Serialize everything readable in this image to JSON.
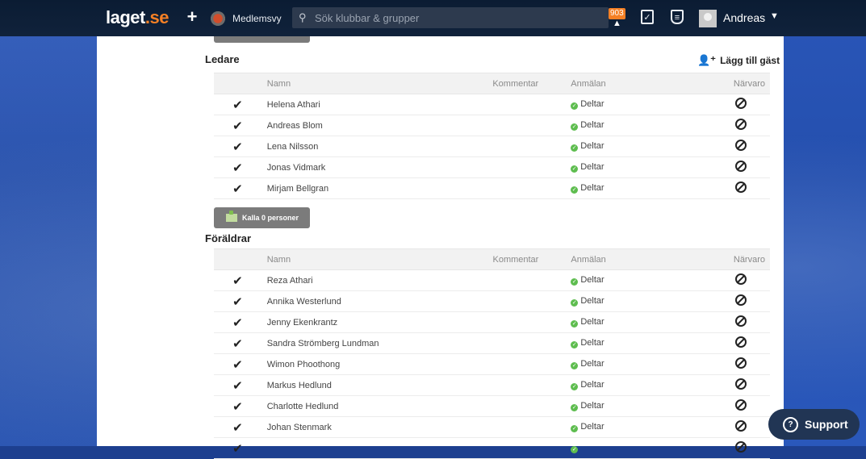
{
  "nav": {
    "logo_main": "laget",
    "logo_suffix": ".se",
    "add_symbol": "+",
    "club_name": "Medlemsvy",
    "search_placeholder": "Sök klubbar & grupper",
    "notifications_count": "903",
    "user_name": "Andreas"
  },
  "ledare": {
    "title": "Ledare",
    "add_guest_label": "Lägg till gäst",
    "columns": {
      "name": "Namn",
      "comment": "Kommentar",
      "signup": "Anmälan",
      "presence": "Närvaro"
    },
    "rows": [
      {
        "name": "Helena Athari",
        "status": "Deltar"
      },
      {
        "name": "Andreas Blom",
        "status": "Deltar"
      },
      {
        "name": "Lena Nilsson",
        "status": "Deltar"
      },
      {
        "name": "Jonas Vidmark",
        "status": "Deltar"
      },
      {
        "name": "Mirjam Bellgran",
        "status": "Deltar"
      }
    ]
  },
  "call_button_label": "Kalla 0 personer",
  "foraldrar": {
    "title": "Föräldrar",
    "columns": {
      "name": "Namn",
      "comment": "Kommentar",
      "signup": "Anmälan",
      "presence": "Närvaro"
    },
    "rows": [
      {
        "name": "Reza Athari",
        "status": "Deltar"
      },
      {
        "name": "Annika Westerlund",
        "status": "Deltar"
      },
      {
        "name": "Jenny Ekenkrantz",
        "status": "Deltar"
      },
      {
        "name": "Sandra Strömberg Lundman",
        "status": "Deltar"
      },
      {
        "name": "Wimon Phoothong",
        "status": "Deltar"
      },
      {
        "name": "Markus Hedlund",
        "status": "Deltar"
      },
      {
        "name": "Charlotte Hedlund",
        "status": "Deltar"
      },
      {
        "name": "Johan Stenmark",
        "status": "Deltar"
      },
      {
        "name": "",
        "status": ""
      }
    ]
  },
  "support_label": "Support",
  "colors": {
    "accent": "#f58025",
    "nav_bg": "#0b1c33",
    "page_bg": "#2a56b8",
    "ok": "#5ebd4f"
  }
}
